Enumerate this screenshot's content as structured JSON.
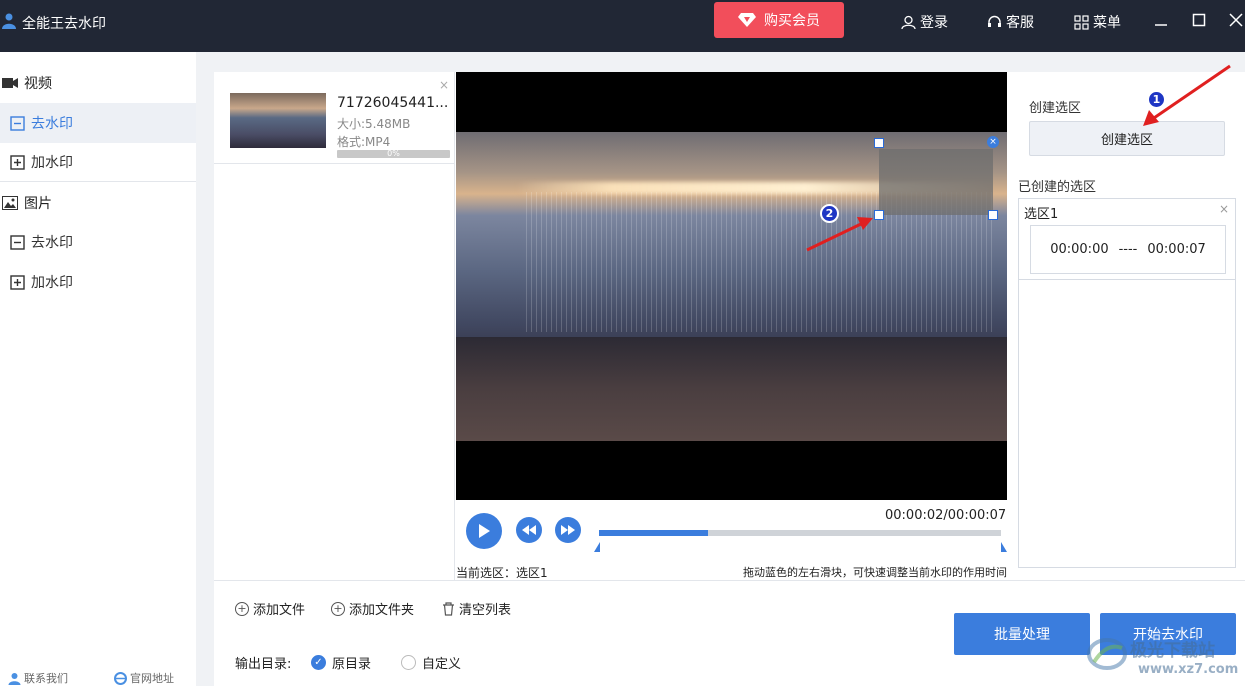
{
  "app": {
    "title": "全能王去水印",
    "vip_label": "购买会员",
    "login_label": "登录",
    "service_label": "客服",
    "menu_label": "菜单"
  },
  "sidebar": {
    "video_section": "视频",
    "video_remove": "去水印",
    "video_add": "加水印",
    "image_section": "图片",
    "image_remove": "去水印",
    "image_add": "加水印",
    "contact": "联系我们",
    "website": "官网地址"
  },
  "file": {
    "name": "71726045441...",
    "size": "大小:5.48MB",
    "format": "格式:MP4",
    "progress": "0%",
    "close": "×"
  },
  "player": {
    "current_time": "00:00:02",
    "total_time": "00:00:07",
    "time_sep": "/",
    "progress_fraction": 0.27,
    "current_selection": "当前选区：选区1",
    "hint": "拖动蓝色的左右滑块，可快速调整当前水印的作用时间"
  },
  "annotations": {
    "badge1": "1",
    "badge2": "2",
    "box_close": "×"
  },
  "region_panel": {
    "create_label": "创建选区",
    "create_button": "创建选区",
    "created_label": "已创建的选区",
    "regions": [
      {
        "name": "选区1",
        "start": "00:00:00",
        "sep": "----",
        "end": "00:00:07",
        "close": "×"
      }
    ]
  },
  "bottom": {
    "add_file": "添加文件",
    "add_folder": "添加文件夹",
    "clear_list": "清空列表",
    "output_label": "输出目录:",
    "opt_original": "原目录",
    "opt_custom": "自定义",
    "batch_button": "批量处理",
    "start_button": "开始去水印"
  },
  "watermark": {
    "brand": "极光下载站",
    "url": "www.xz7.com"
  },
  "colors": {
    "accent": "#3b7ddd",
    "vip": "#f24e5b",
    "titlebar": "#212735"
  }
}
